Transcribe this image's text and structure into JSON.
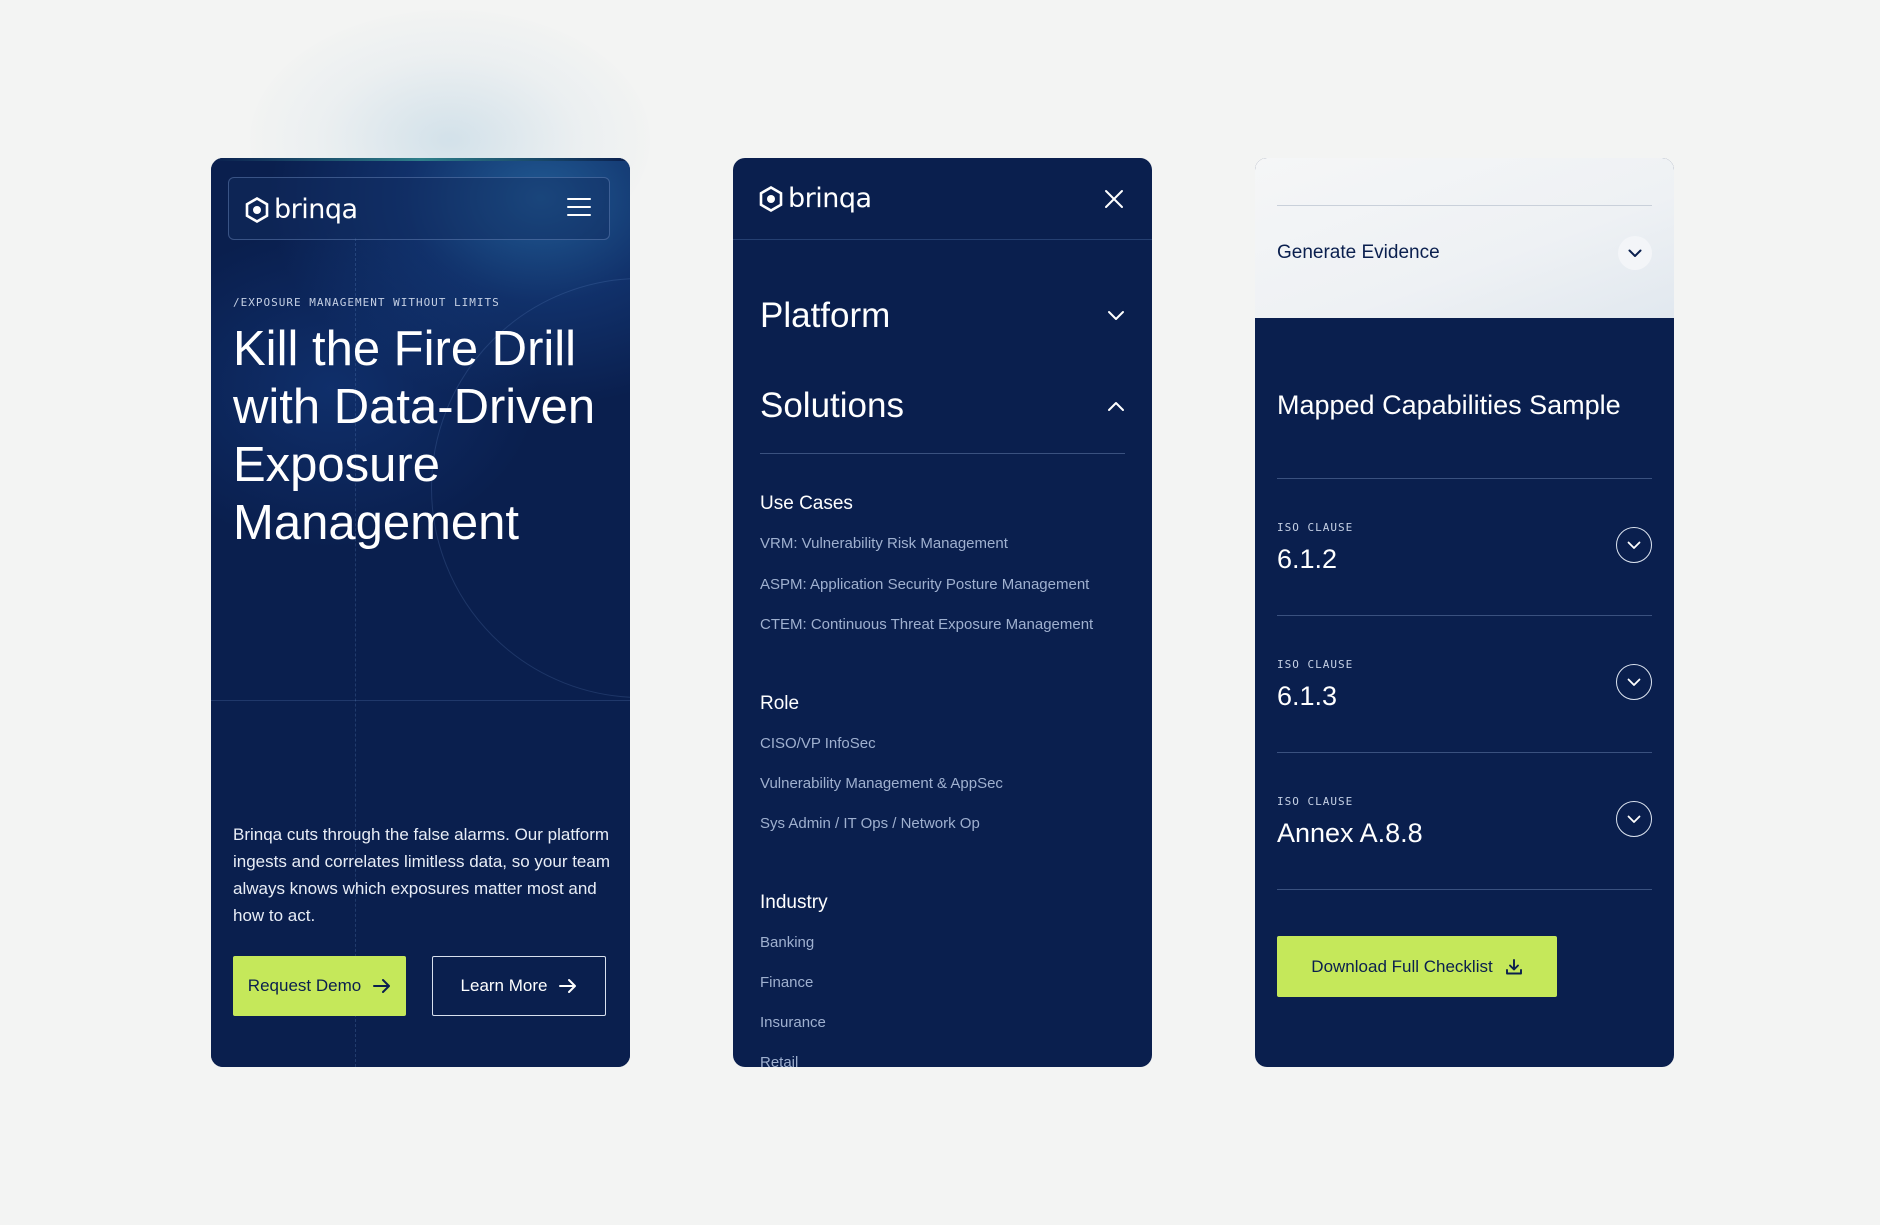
{
  "colors": {
    "navy": "#0a1f4e",
    "lime": "#c5e85a",
    "canvas": "#f3f4f3"
  },
  "brand": {
    "name": "brinqa"
  },
  "hero": {
    "eyebrow": "/EXPOSURE MANAGEMENT WITHOUT LIMITS",
    "title": "Kill the Fire Drill with Data-Driven Exposure Management",
    "body": "Brinqa cuts through the false alarms. Our platform ingests and correlates limitless data, so your team always knows which exposures matter most and how to act.",
    "primary_cta": "Request Demo",
    "secondary_cta": "Learn More"
  },
  "menu": {
    "top_items": [
      {
        "label": "Platform",
        "state": "collapsed"
      },
      {
        "label": "Solutions",
        "state": "expanded"
      }
    ],
    "groups": [
      {
        "heading": "Use Cases",
        "links": [
          "VRM: Vulnerability Risk Management",
          "ASPM: Application Security Posture Management",
          "CTEM: Continuous Threat Exposure Management"
        ]
      },
      {
        "heading": "Role",
        "links": [
          "CISO/VP InfoSec",
          "Vulnerability Management & AppSec",
          "Sys Admin / IT Ops / Network Op"
        ]
      },
      {
        "heading": "Industry",
        "links": [
          "Banking",
          "Finance",
          "Insurance",
          "Retail"
        ]
      }
    ]
  },
  "capabilities": {
    "generate_label": "Generate Evidence",
    "title": "Mapped Capabilities Sample",
    "clauses": [
      {
        "tag": "ISO CLAUSE",
        "value": "6.1.2"
      },
      {
        "tag": "ISO CLAUSE",
        "value": "6.1.3"
      },
      {
        "tag": "ISO CLAUSE",
        "value": "Annex A.8.8"
      }
    ],
    "download_cta": "Download Full Checklist"
  }
}
